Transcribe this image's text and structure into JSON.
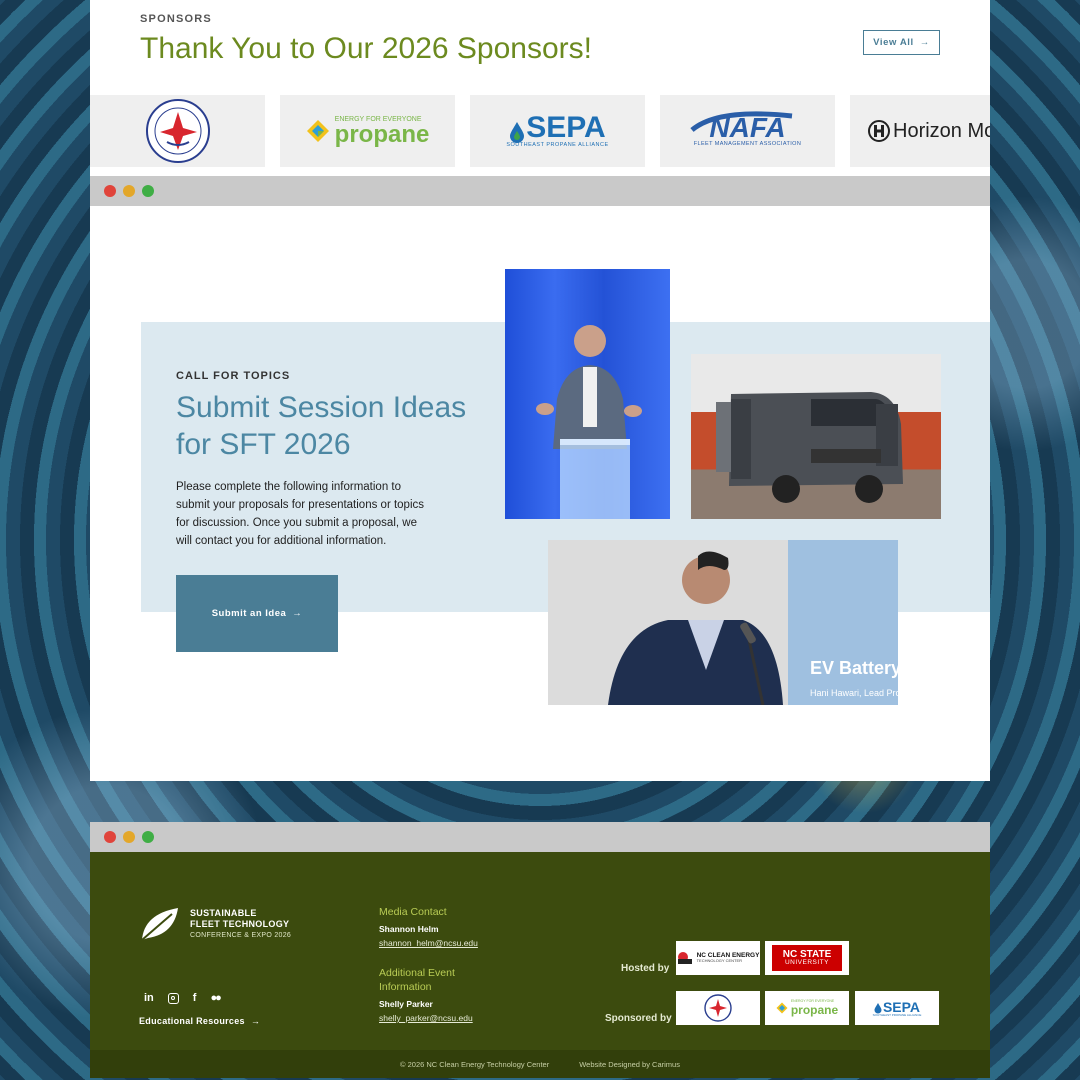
{
  "sponsors": {
    "eyebrow": "SPONSORS",
    "title": "Thank You to Our 2026 Sponsors!",
    "view_all": "View All",
    "logos": [
      {
        "name": "NC DOT",
        "ring": "STATE OF NORTH CAROLINA · DEPARTMENT OF TRANSPORTATION"
      },
      {
        "name": "propane",
        "tag": "ENERGY FOR EVERYONE",
        "word": "propane"
      },
      {
        "name": "SEPA",
        "word": "SEPA",
        "tag": "SOUTHEAST PROPANE ALLIANCE"
      },
      {
        "name": "NAFA",
        "word": "NAFA",
        "tag": "FLEET MANAGEMENT ASSOCIATION"
      },
      {
        "name": "Horizon",
        "word": "Horizon Mot"
      }
    ]
  },
  "call": {
    "eyebrow": "CALL FOR TOPICS",
    "title": "Submit Session Ideas for SFT 2026",
    "body": "Please complete the following information to submit your proposals for presentations or topics for discussion. Once you submit a proposal, we will contact you for additional information.",
    "button": "Submit an Idea",
    "slide_title": "EV Battery",
    "slide_sub": "Hani Hawari, Lead Pro"
  },
  "footer": {
    "brand_line1": "SUSTAINABLE",
    "brand_line2": "FLEET TECHNOLOGY",
    "brand_sub": "CONFERENCE & EXPO 2026",
    "edu": "Educational Resources",
    "media_heading": "Media Contact",
    "media_name": "Shannon Helm",
    "media_email": "shannon_helm@ncsu.edu",
    "event_heading": "Additional Event Information",
    "event_name": "Shelly Parker",
    "event_email": "shelly_parker@ncsu.edu",
    "hosted_by": "Hosted by",
    "sponsored_by": "Sponsored by",
    "host_logos": [
      {
        "line1": "NC CLEAN ENERGY",
        "line2": "TECHNOLOGY CENTER"
      },
      {
        "line1": "NC STATE",
        "line2": "UNIVERSITY"
      }
    ],
    "sponsor_logos": [
      {
        "word": "propane",
        "tag": "ENERGY FOR EVERYONE"
      },
      {
        "word": "SEPA",
        "tag": "SOUTHEAST PROPANE ALLIANCE"
      }
    ],
    "copyright": "© 2026 NC Clean Energy Technology Center",
    "designer": "Website Designed by Carimus"
  },
  "colors": {
    "accent_green": "#6c8a1f",
    "teal": "#4a7d95",
    "footer_bg": "#3c4b0e"
  }
}
